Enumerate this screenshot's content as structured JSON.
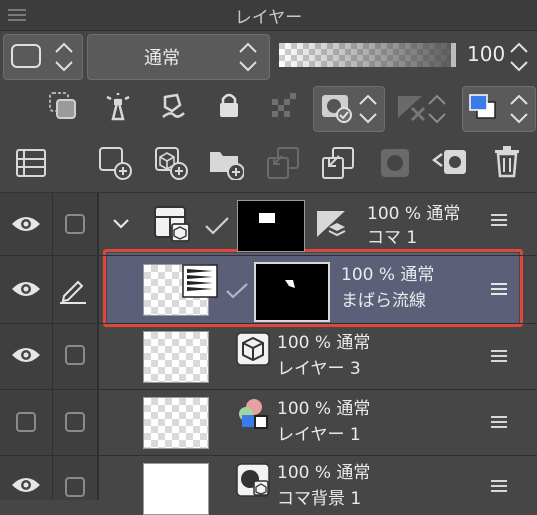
{
  "panel": {
    "title": "レイヤー"
  },
  "toolbar1": {
    "blend_mode": "通常",
    "opacity_value": "100",
    "opacity_fraction": 1.0
  },
  "layers": [
    {
      "opacity": "100 %",
      "blend": "通常",
      "name": "コマ 1"
    },
    {
      "opacity": "100 %",
      "blend": "通常",
      "name": "まばら流線"
    },
    {
      "opacity": "100 %",
      "blend": "通常",
      "name": "レイヤー 3"
    },
    {
      "opacity": "100 %",
      "blend": "通常",
      "name": "レイヤー 1"
    },
    {
      "opacity": "100 %",
      "blend": "通常",
      "name": "コマ背景 1"
    }
  ],
  "colors": {
    "selected_row": "#5b6078",
    "highlight_border": "#e0473b",
    "main_color": "#3a7be8"
  }
}
